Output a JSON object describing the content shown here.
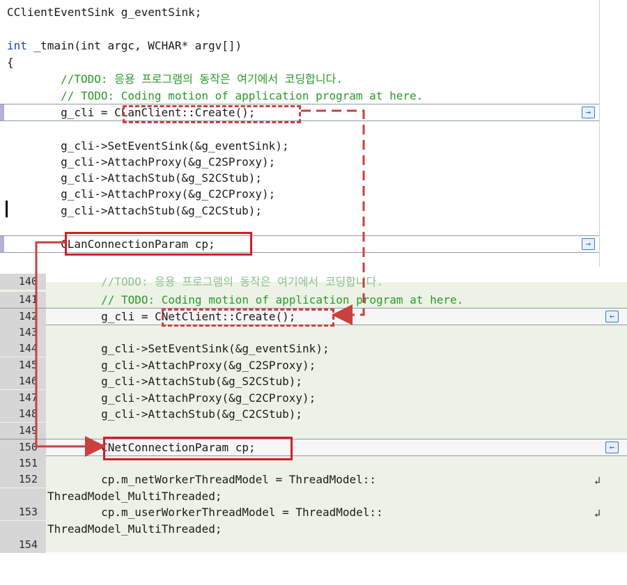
{
  "top_pane": {
    "lines": [
      {
        "code": "CClientEventSink g_eventSink;"
      },
      {
        "code": ""
      },
      {
        "kw": "int",
        "code": " _tmain(int argc, WCHAR* argv[])"
      },
      {
        "code": "{"
      },
      {
        "comment": "        //TODO: 응용 프로그램의 동작은 여기에서 코딩합니다."
      },
      {
        "comment": "        // TODO: Coding motion of application program at here."
      },
      {
        "code": "        g_cli = CLanClient::Create();"
      },
      {
        "code": ""
      },
      {
        "code": "        g_cli->SetEventSink(&g_eventSink);"
      },
      {
        "code": "        g_cli->AttachProxy(&g_C2SProxy);"
      },
      {
        "code": "        g_cli->AttachStub(&g_S2CStub);"
      },
      {
        "code": "        g_cli->AttachProxy(&g_C2CProxy);"
      },
      {
        "code": "        g_cli->AttachStub(&g_C2CStub);"
      },
      {
        "code": ""
      },
      {
        "code": "        CLanConnectionParam cp;"
      }
    ]
  },
  "bottom_pane": {
    "partial_line": "        //TODO: 응용 프로그램의 동작은 여기에서 코딩합니다.",
    "partial_lnum": "140",
    "lines": [
      {
        "n": "141",
        "comment": "        // TODO: Coding motion of application program at here."
      },
      {
        "n": "142",
        "code": "        g_cli = CNetClient::Create();"
      },
      {
        "n": "143",
        "code": ""
      },
      {
        "n": "144",
        "code": "        g_cli->SetEventSink(&g_eventSink);"
      },
      {
        "n": "145",
        "code": "        g_cli->AttachProxy(&g_C2SProxy);"
      },
      {
        "n": "146",
        "code": "        g_cli->AttachStub(&g_S2CStub);"
      },
      {
        "n": "147",
        "code": "        g_cli->AttachProxy(&g_C2CProxy);"
      },
      {
        "n": "148",
        "code": "        g_cli->AttachStub(&g_C2CStub);"
      },
      {
        "n": "149",
        "code": ""
      },
      {
        "n": "150",
        "code": "        CNetConnectionParam cp;"
      },
      {
        "n": "151",
        "code": ""
      },
      {
        "n": "152",
        "code": "        cp.m_netWorkerThreadModel = ThreadModel::"
      },
      {
        "n": "",
        "code": "ThreadModel_MultiThreaded;"
      },
      {
        "n": "153",
        "code": "        cp.m_userWorkerThreadModel = ThreadModel::"
      },
      {
        "n": "",
        "code": "ThreadModel_MultiThreaded;"
      },
      {
        "n": "154",
        "code": ""
      }
    ]
  },
  "icons": {
    "nav_right": "→",
    "nav_left": "←",
    "wrap": "↲"
  },
  "colors": {
    "highlight_box": "#d31c2a",
    "dashed_box": "#c9403f",
    "connector": "#c9403f",
    "keyword": "#1f3fbf",
    "comment": "#2a9a2a",
    "diff_background": "#ecf3e6"
  }
}
